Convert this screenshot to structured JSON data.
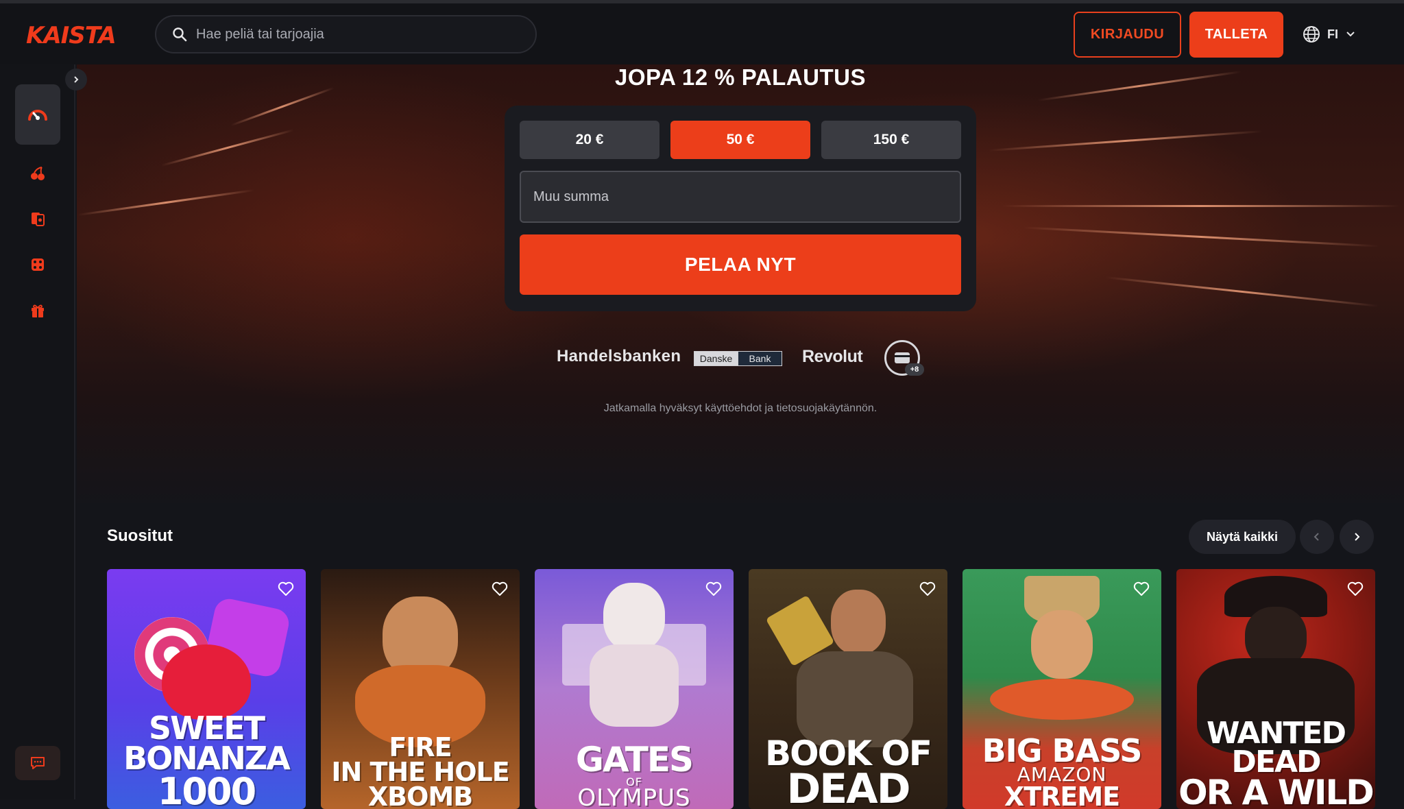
{
  "header": {
    "logo_text": "KAISTA",
    "search_placeholder": "Hae peliä tai tarjoajia",
    "login_label": "KIRJAUDU",
    "deposit_label": "TALLETA",
    "language": "FI"
  },
  "sidebar": {
    "items": [
      "speedometer-icon",
      "cherries-icon",
      "cards-icon",
      "dice-icon",
      "gift-icon"
    ],
    "chat_icon": "chat-icon"
  },
  "hero": {
    "title": "JOPA 12 % PALAUTUS",
    "amounts": [
      "20 €",
      "50 €",
      "150 €"
    ],
    "selected_amount": "50 €",
    "other_amount_placeholder": "Muu summa",
    "play_label": "PELAA NYT",
    "banks": {
      "handelsbanken": "Handelsbanken",
      "danske_left": "Danske",
      "danske_right": "Bank",
      "revolut": "Revolut",
      "more_badge": "+8"
    },
    "terms": "Jatkamalla hyväksyt käyttöehdot ja tietosuojakäytännön."
  },
  "popular": {
    "title": "Suositut",
    "show_all_label": "Näytä kaikki",
    "games": [
      {
        "line1": "SWEET BONANZA",
        "line2": "1000",
        "bg1": "#7a3cf0",
        "bg2": "#3b5ee0"
      },
      {
        "line1": "FIRE",
        "line2": "IN THE HOLE",
        "line3": "XBOMB",
        "bg1": "#3a2416",
        "bg2": "#b5652a"
      },
      {
        "line1": "GATES",
        "small": "OF",
        "line2": "OLYMPUS",
        "bg1": "#8a5ad0",
        "bg2": "#c06ab8"
      },
      {
        "line1": "BOOK OF",
        "line2": "DEAD",
        "bg1": "#3a2a1a",
        "bg2": "#6a4a22"
      },
      {
        "line1": "BIG BASS",
        "small": "AMAZON",
        "line2": "XTREME",
        "bg1": "#2f8a4a",
        "bg2": "#d13a2a"
      },
      {
        "line1": "WANTED DEAD",
        "line2": "OR A WILD",
        "bg1": "#8a1a12",
        "bg2": "#3a0e0c"
      }
    ]
  },
  "colors": {
    "accent": "#ec3e1a",
    "background": "#14151a",
    "panel": "#1a1b20"
  }
}
